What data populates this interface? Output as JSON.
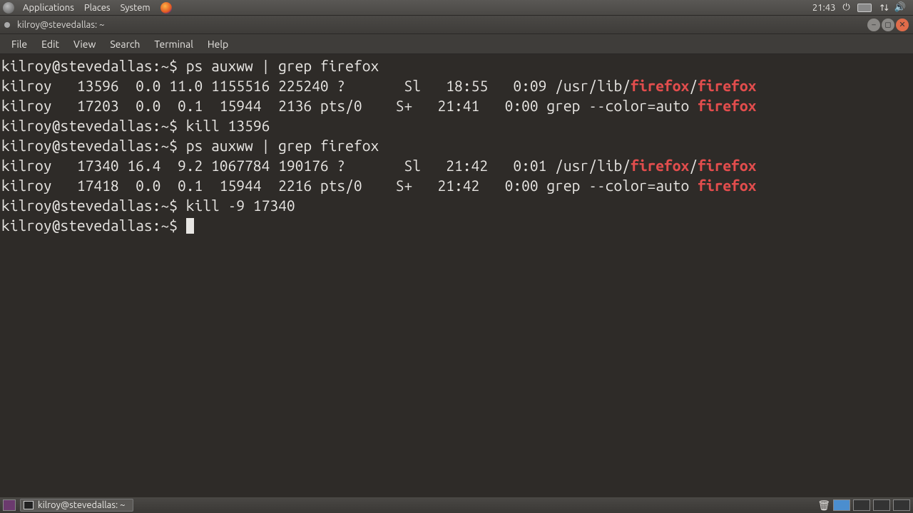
{
  "panel": {
    "menus": [
      "Applications",
      "Places",
      "System"
    ],
    "clock": "21:43"
  },
  "window": {
    "title": "kilroy@stevedallas: ~"
  },
  "menubar": {
    "items": [
      "File",
      "Edit",
      "View",
      "Search",
      "Terminal",
      "Help"
    ]
  },
  "term": {
    "prompt": "kilroy@stevedallas:~$ ",
    "lines": {
      "cmd1": "ps auxww | grep firefox",
      "out1a_pre": "kilroy   13596  0.0 11.0 1155516 225240 ?       Sl   18:55   0:09 /usr/lib/",
      "out1a_h1": "firefox",
      "out1a_mid": "/",
      "out1a_h2": "firefox",
      "out1b_pre": "kilroy   17203  0.0  0.1  15944  2136 pts/0    S+   21:41   0:00 grep --color=auto ",
      "out1b_h1": "firefox",
      "cmd2": "kill 13596",
      "cmd3": "ps auxww | grep firefox",
      "out2a_pre": "kilroy   17340 16.4  9.2 1067784 190176 ?       Sl   21:42   0:01 /usr/lib/",
      "out2a_h1": "firefox",
      "out2a_mid": "/",
      "out2a_h2": "firefox",
      "out2b_pre": "kilroy   17418  0.0  0.1  15944  2216 pts/0    S+   21:42   0:00 grep --color=auto ",
      "out2b_h1": "firefox",
      "cmd4": "kill -9 17340"
    }
  },
  "taskbar": {
    "task_title": "kilroy@stevedallas: ~"
  }
}
